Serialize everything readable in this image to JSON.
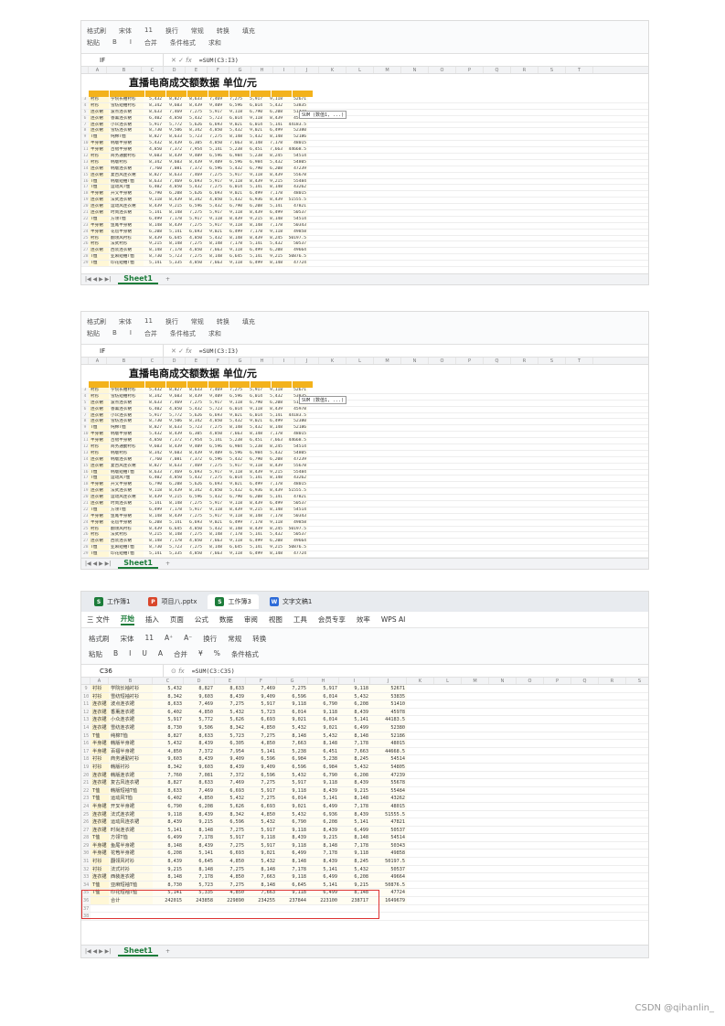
{
  "app": {
    "font_name": "宋体",
    "font_size": "11",
    "toolbar": [
      "格式刷",
      "粘贴",
      "换行",
      "常规",
      "转换",
      "合并",
      "条件格式",
      "填充",
      "求和"
    ]
  },
  "shot1": {
    "name_box": "IF",
    "formula": "=SUM(C3:I3)",
    "title": "直播电商成交额数据 单位/元",
    "tooltip": "SUM (数值1, ...)",
    "editing_cell": "=SUM(C3:I3)",
    "sheet_tab": "Sheet1",
    "add_sheet": "+"
  },
  "shot2": {
    "name_box": "IF",
    "formula": "=SUM(C3:I3)",
    "title": "直播电商成交额数据 单位/元",
    "tooltip": "SUM (数值1, ...)",
    "sheet_tab": "Sheet1",
    "add_sheet": "+"
  },
  "shot3": {
    "tabs": [
      {
        "label": "工作簿1",
        "icon": "S",
        "color": "#1c7c3a"
      },
      {
        "label": "项目八.pptx",
        "icon": "P",
        "color": "#d9472b"
      },
      {
        "label": "工作簿3",
        "icon": "S",
        "color": "#1c7c3a"
      },
      {
        "label": "文字文稿1",
        "icon": "W",
        "color": "#2d6bd8"
      }
    ],
    "menu": [
      "三 文件",
      "开始",
      "插入",
      "页面",
      "公式",
      "数据",
      "审阅",
      "视图",
      "工具",
      "会员专享",
      "效率",
      "WPS AI"
    ],
    "ribbon_row1": [
      "格式刷",
      "宋体",
      "11",
      "A⁺",
      "A⁻",
      "换行",
      "常规",
      "转换"
    ],
    "ribbon_row2": [
      "粘贴",
      "B",
      "I",
      "U",
      "A",
      "合并",
      "¥",
      "%",
      "条件格式"
    ],
    "name_box": "C36",
    "formula": "=SUM(C3:C35)",
    "sheet_tab": "Sheet1",
    "add_sheet": "+",
    "columns": [
      "A",
      "B",
      "C",
      "D",
      "E",
      "F",
      "G",
      "H",
      "I",
      "J",
      "K",
      "L",
      "M",
      "N",
      "O",
      "P",
      "Q",
      "R",
      "S",
      "T"
    ],
    "rows": [
      {
        "n": "9",
        "cat": "衬衫",
        "shop": "学院长袖衬衫",
        "v": [
          "5,432",
          "8,827",
          "8,633",
          "7,469",
          "7,275",
          "5,917",
          "9,118",
          "52671"
        ]
      },
      {
        "n": "10",
        "cat": "衬衫",
        "shop": "雪纺短袖衬衫",
        "v": [
          "8,342",
          "9,603",
          "8,439",
          "9,409",
          "6,596",
          "6,014",
          "5,432",
          "53835"
        ]
      },
      {
        "n": "11",
        "cat": "连衣裙",
        "shop": "波点连衣裙",
        "v": [
          "8,633",
          "7,469",
          "7,275",
          "5,917",
          "9,118",
          "6,790",
          "6,208",
          "51410"
        ]
      },
      {
        "n": "12",
        "cat": "连衣裙",
        "shop": "香薰连衣裙",
        "v": [
          "6,402",
          "4,850",
          "5,432",
          "5,723",
          "6,014",
          "9,118",
          "8,439",
          "45978"
        ]
      },
      {
        "n": "13",
        "cat": "连衣裙",
        "shop": "小众连衣裙",
        "v": [
          "5,917",
          "5,772",
          "5,626",
          "6,693",
          "9,021",
          "6,014",
          "5,141",
          "44183.5"
        ]
      },
      {
        "n": "14",
        "cat": "连衣裙",
        "shop": "雪纺连衣裙",
        "v": [
          "8,730",
          "9,506",
          "8,342",
          "4,850",
          "5,432",
          "9,021",
          "6,499",
          "52380"
        ]
      },
      {
        "n": "15",
        "cat": "T恤",
        "shop": "纯棉T恤",
        "v": [
          "8,827",
          "8,633",
          "5,723",
          "7,275",
          "8,148",
          "5,432",
          "8,148",
          "52186"
        ]
      },
      {
        "n": "16",
        "cat": "半身裙",
        "shop": "韩版半身裙",
        "v": [
          "5,432",
          "8,439",
          "6,305",
          "4,850",
          "7,663",
          "8,148",
          "7,178",
          "48015"
        ]
      },
      {
        "n": "17",
        "cat": "半身裙",
        "shop": "百褶半身裙",
        "v": [
          "4,850",
          "7,372",
          "7,954",
          "5,141",
          "5,238",
          "6,451",
          "7,663",
          "44668.5"
        ]
      },
      {
        "n": "18",
        "cat": "衬衫",
        "shop": "商务通勤衬衫",
        "v": [
          "9,603",
          "8,439",
          "9,409",
          "6,596",
          "6,984",
          "5,238",
          "8,245",
          "54514"
        ]
      },
      {
        "n": "19",
        "cat": "衬衫",
        "shop": "韩版衬衫",
        "v": [
          "8,342",
          "9,603",
          "8,439",
          "9,409",
          "6,596",
          "6,984",
          "5,432",
          "54805"
        ]
      },
      {
        "n": "20",
        "cat": "连衣裙",
        "shop": "韩版连衣裙",
        "v": [
          "7,760",
          "7,081",
          "7,372",
          "6,596",
          "5,432",
          "6,790",
          "6,208",
          "47239"
        ]
      },
      {
        "n": "21",
        "cat": "连衣裙",
        "shop": "复古风连衣裙",
        "v": [
          "8,827",
          "8,633",
          "7,469",
          "7,275",
          "5,917",
          "9,118",
          "8,439",
          "55678"
        ]
      },
      {
        "n": "22",
        "cat": "T恤",
        "shop": "韩版短袖T恤",
        "v": [
          "8,633",
          "7,469",
          "6,693",
          "5,917",
          "9,118",
          "8,439",
          "9,215",
          "55484"
        ]
      },
      {
        "n": "23",
        "cat": "T恤",
        "shop": "运动风T恤",
        "v": [
          "6,402",
          "4,850",
          "5,432",
          "7,275",
          "6,014",
          "5,141",
          "8,148",
          "43262"
        ]
      },
      {
        "n": "24",
        "cat": "半身裙",
        "shop": "开叉半身裙",
        "v": [
          "6,790",
          "6,208",
          "5,626",
          "6,693",
          "9,021",
          "6,499",
          "7,178",
          "48015"
        ]
      },
      {
        "n": "25",
        "cat": "连衣裙",
        "shop": "法式连衣裙",
        "v": [
          "9,118",
          "8,439",
          "8,342",
          "4,850",
          "5,432",
          "6,936",
          "8,439",
          "51555.5"
        ]
      },
      {
        "n": "26",
        "cat": "连衣裙",
        "shop": "运动风连衣裙",
        "v": [
          "8,439",
          "9,215",
          "6,596",
          "5,432",
          "6,790",
          "6,208",
          "5,141",
          "47821"
        ]
      },
      {
        "n": "27",
        "cat": "连衣裙",
        "shop": "时尚连衣裙",
        "v": [
          "5,141",
          "8,148",
          "7,275",
          "5,917",
          "9,118",
          "8,439",
          "6,499",
          "50537"
        ]
      },
      {
        "n": "28",
        "cat": "T恤",
        "shop": "方领T恤",
        "v": [
          "6,499",
          "7,178",
          "5,917",
          "9,118",
          "8,439",
          "9,215",
          "8,148",
          "54514"
        ]
      },
      {
        "n": "29",
        "cat": "半身裙",
        "shop": "鱼尾半身裙",
        "v": [
          "8,148",
          "8,439",
          "7,275",
          "5,917",
          "9,118",
          "8,148",
          "7,178",
          "50343"
        ]
      },
      {
        "n": "30",
        "cat": "半身裙",
        "shop": "花苞半身裙",
        "v": [
          "6,208",
          "5,141",
          "6,693",
          "9,021",
          "6,499",
          "7,178",
          "9,118",
          "49858"
        ]
      },
      {
        "n": "31",
        "cat": "衬衫",
        "shop": "翻领风衬衫",
        "v": [
          "8,439",
          "6,645",
          "4,850",
          "5,432",
          "8,148",
          "8,439",
          "8,245",
          "50197.5"
        ]
      },
      {
        "n": "32",
        "cat": "衬衫",
        "shop": "法式衬衫",
        "v": [
          "9,215",
          "8,148",
          "7,275",
          "8,148",
          "7,178",
          "5,141",
          "5,432",
          "50537"
        ]
      },
      {
        "n": "33",
        "cat": "连衣裙",
        "shop": "西装连衣裙",
        "v": [
          "8,148",
          "7,178",
          "4,850",
          "7,663",
          "9,118",
          "6,499",
          "6,208",
          "49664"
        ]
      },
      {
        "n": "34",
        "cat": "T恤",
        "shop": "亚麻短袖T恤",
        "v": [
          "8,730",
          "5,723",
          "7,275",
          "8,148",
          "6,645",
          "5,141",
          "9,215",
          "50876.5"
        ]
      },
      {
        "n": "35",
        "cat": "T恤",
        "shop": "印花短袖T恤",
        "v": [
          "5,141",
          "5,335",
          "4,850",
          "7,663",
          "9,118",
          "6,499",
          "8,148",
          "47724"
        ]
      }
    ],
    "total_row": {
      "n": "36",
      "label": "合计",
      "v": [
        "242015",
        "243858",
        "229890",
        "234255",
        "237844",
        "223100",
        "238717",
        "1649679"
      ]
    },
    "empty_rows": [
      "37",
      "38"
    ]
  },
  "credit": "CSDN @qihanlin_"
}
